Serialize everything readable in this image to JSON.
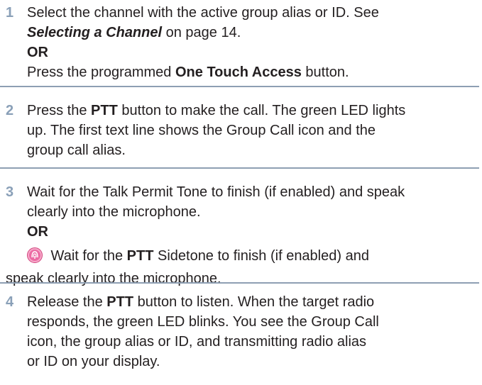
{
  "steps": [
    {
      "number": "1",
      "line1": "Select the channel with the active group alias or ID. See",
      "line2_link": "Selecting a Channel",
      "line2_rest": " on page 14.",
      "or": "OR",
      "line4_pre": "Press the programmed ",
      "line4_bold": "One Touch Access",
      "line4_post": " button."
    },
    {
      "number": "2",
      "line1_pre": "Press the ",
      "line1_bold": "PTT",
      "line1_post": " button to make the call. The green LED lights",
      "line2": "up. The first text line shows the Group Call icon and the",
      "line3": "group call alias."
    },
    {
      "number": "3",
      "line1": "Wait for the Talk Permit Tone to finish (if enabled) and speak",
      "line2": "clearly into the microphone.",
      "or": "OR",
      "line4_pre": " Wait for the ",
      "line4_bold": "PTT",
      "line4_post": " Sidetone to finish (if enabled) and",
      "line5": "speak clearly into the microphone.",
      "icon": "sidetone-icon"
    },
    {
      "number": "4",
      "line1_pre": "Release the ",
      "line1_bold": "PTT",
      "line1_post": " button to listen. When the target radio",
      "line2": "responds, the green LED blinks. You see the Group Call",
      "line3": "icon, the group alias or ID, and transmitting radio alias",
      "line4": "or ID on your display."
    }
  ],
  "colors": {
    "step_number": "#8aa0b8",
    "separator": "#8e9fb3",
    "text": "#231f20",
    "icon_fill": "#e8579a"
  }
}
